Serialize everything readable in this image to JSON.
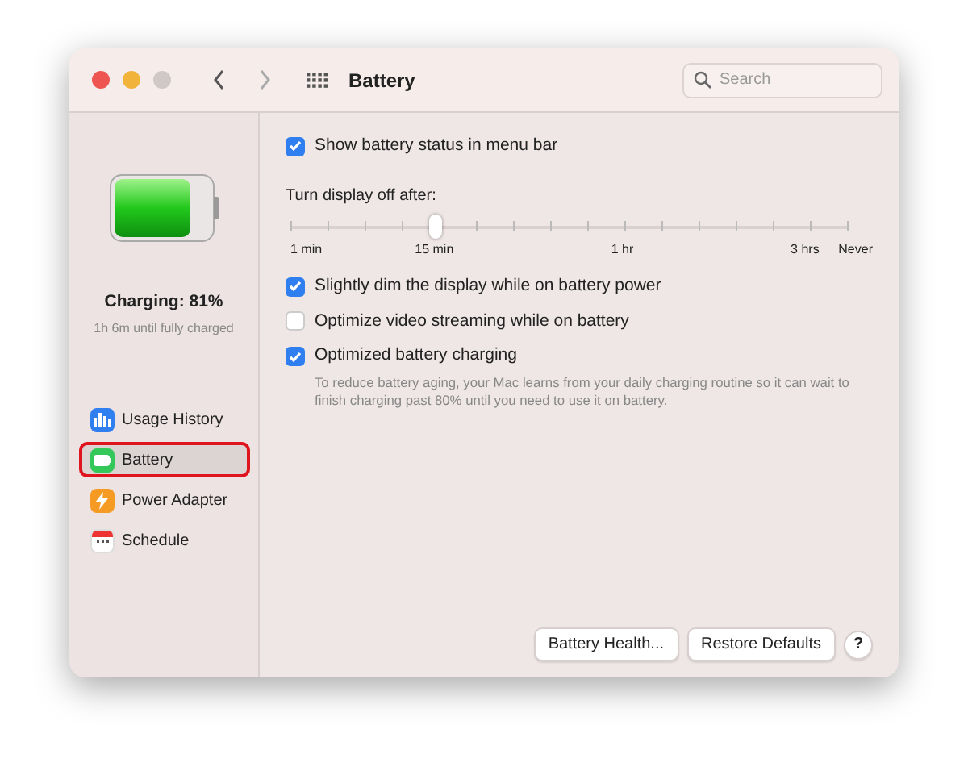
{
  "window": {
    "title": "Battery",
    "search": {
      "placeholder": "Search"
    }
  },
  "sidebar": {
    "battery_gauge": {
      "level": 0.81
    },
    "status": "Charging: 81%",
    "substatus": "1h 6m until fully charged",
    "items": [
      {
        "label": "Usage History",
        "kind": "history",
        "selected": false,
        "highlighted": false
      },
      {
        "label": "Battery",
        "kind": "battery",
        "selected": true,
        "highlighted": true
      },
      {
        "label": "Power Adapter",
        "kind": "adapter",
        "selected": false,
        "highlighted": false
      },
      {
        "label": "Schedule",
        "kind": "schedule",
        "selected": false,
        "highlighted": false
      }
    ]
  },
  "settings": [
    {
      "kind": "checkbox",
      "label": "Show battery status in menu bar",
      "checked": true
    },
    {
      "kind": "slider",
      "label": "Turn display off after:",
      "level": 0.26,
      "ticks": [
        "1 min",
        "15 min",
        "1 hr",
        "3 hrs",
        "Never"
      ]
    },
    {
      "kind": "checkbox",
      "label": "Slightly dim the display while on battery power",
      "checked": true
    },
    {
      "kind": "checkbox",
      "label": "Optimize video streaming while on battery",
      "checked": false
    },
    {
      "kind": "checkbox",
      "label": "Optimized battery charging",
      "checked": true,
      "note": "To reduce battery aging, your Mac learns from your daily charging routine so it can wait to finish charging past 80% until you need to use it on battery."
    }
  ],
  "buttons": [
    "Battery Health...",
    "Restore Defaults",
    "?"
  ]
}
